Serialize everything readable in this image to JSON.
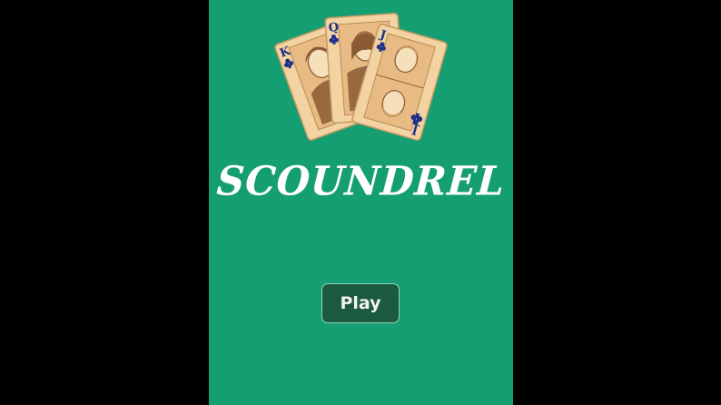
{
  "game": {
    "title": "SCOUNDREL",
    "play_label": "Play"
  },
  "cards": [
    {
      "rank": "K",
      "suit": "clubs"
    },
    {
      "rank": "Q",
      "suit": "clubs"
    },
    {
      "rank": "J",
      "suit": "clubs"
    }
  ],
  "colors": {
    "background": "#000000",
    "table_green": "#159e72",
    "button_fill": "#1b5a3e",
    "button_border": "#8fd7bd",
    "card_face": "#f3d3a1",
    "card_ink": "#1f2f8a",
    "portrait": "#8a5a34"
  }
}
